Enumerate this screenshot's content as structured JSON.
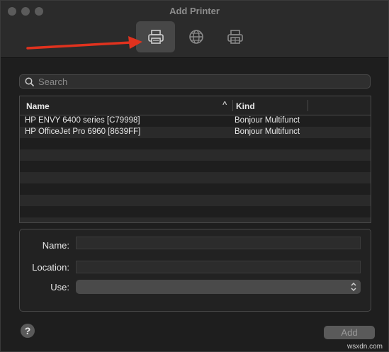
{
  "window": {
    "title": "Add Printer"
  },
  "toolbar": {
    "buttons": [
      {
        "icon": "printer-icon",
        "selected": true
      },
      {
        "icon": "globe-icon",
        "selected": false
      },
      {
        "icon": "windows-printer-icon",
        "selected": false
      }
    ]
  },
  "search": {
    "placeholder": "Search",
    "value": ""
  },
  "table": {
    "columns": [
      "Name",
      "Kind"
    ],
    "sort_indicator": "^",
    "rows": [
      {
        "name": "HP ENVY 6400 series [C79998]",
        "kind": "Bonjour Multifunct"
      },
      {
        "name": "HP OfficeJet Pro 6960 [8639FF]",
        "kind": "Bonjour Multifunct"
      }
    ]
  },
  "form": {
    "name_label": "Name:",
    "location_label": "Location:",
    "use_label": "Use:",
    "name_value": "",
    "location_value": "",
    "use_value": ""
  },
  "footer": {
    "help_label": "?",
    "add_label": "Add"
  },
  "watermark": "wsxdn.com",
  "colors": {
    "annotation_arrow": "#e0321e",
    "selected_toolbar": "#474747"
  }
}
